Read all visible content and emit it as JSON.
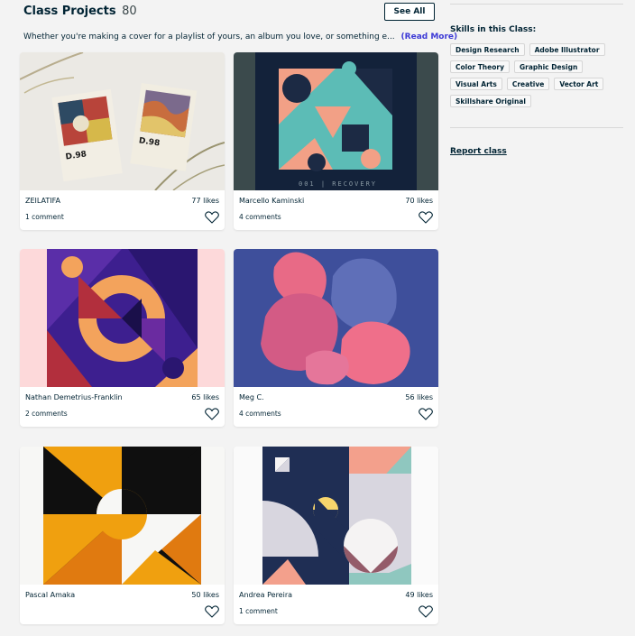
{
  "section": {
    "title": "Class Projects",
    "count": "80",
    "see_all_label": "See All",
    "description": "Whether you're making a cover for a playlist of yours, an album you love, or something e...",
    "read_more_label": "(Read More)"
  },
  "projects": [
    {
      "author": "ZEILATIFA",
      "likes": "77 likes",
      "comments": "1 comment"
    },
    {
      "author": "Marcello Kaminski",
      "likes": "70 likes",
      "comments": "4 comments"
    },
    {
      "author": "Nathan Demetrius-Franklin",
      "likes": "65 likes",
      "comments": "2 comments"
    },
    {
      "author": "Meg C.",
      "likes": "56 likes",
      "comments": "4 comments"
    },
    {
      "author": "Pascal Amaka",
      "likes": "50 likes",
      "comments": ""
    },
    {
      "author": "Andrea Pereira",
      "likes": "49 likes",
      "comments": "1 comment"
    }
  ],
  "thumbnail_texts": {
    "zeilatifa_poster_left": "D.98",
    "zeilatifa_poster_right": "D.98",
    "marcello_caption": "001 | RECOVERY"
  },
  "sidebar": {
    "skills_title": "Skills in this Class:",
    "skills": [
      "Design Research",
      "Adobe Illustrator",
      "Color Theory",
      "Graphic Design",
      "Visual Arts",
      "Creative",
      "Vector Art",
      "Skillshare Original"
    ],
    "report_label": "Report class"
  },
  "colors": {
    "text_dark": "#002333",
    "read_more": "#3d3ad6",
    "background": "#f3f3f3"
  },
  "icons": {
    "heart": "heart-icon"
  }
}
